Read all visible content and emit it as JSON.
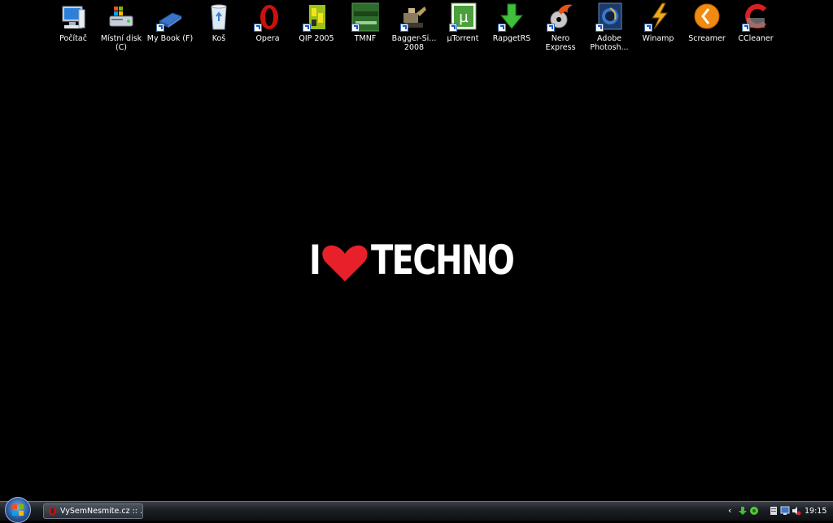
{
  "desktop": {
    "icons": [
      {
        "label": "Počítač",
        "icon": "computer-icon"
      },
      {
        "label": "Místní disk\n(C)",
        "icon": "local-disk-icon"
      },
      {
        "label": "My Book (F)",
        "icon": "external-drive-icon"
      },
      {
        "label": "Koš",
        "icon": "recycle-bin-icon"
      },
      {
        "label": "Opera",
        "icon": "opera-icon"
      },
      {
        "label": "QIP 2005",
        "icon": "qip-icon"
      },
      {
        "label": "TMNF",
        "icon": "tmnf-icon"
      },
      {
        "label": "Bagger-Si...\n2008",
        "icon": "bagger-simulator-icon"
      },
      {
        "label": "µTorrent",
        "icon": "utorrent-icon"
      },
      {
        "label": "RapgetRS",
        "icon": "rapget-icon"
      },
      {
        "label": "Nero Express",
        "icon": "nero-icon"
      },
      {
        "label": "Adobe\nPhotosh...",
        "icon": "photoshop-icon"
      },
      {
        "label": "Winamp",
        "icon": "winamp-icon"
      },
      {
        "label": "Screamer",
        "icon": "screamer-icon"
      },
      {
        "label": "CCleaner",
        "icon": "ccleaner-icon"
      }
    ],
    "wallpaper": {
      "part1": "I",
      "part2": "TECHNO",
      "heart_color": "#e8202a"
    }
  },
  "taskbar": {
    "start_icon": "windows-start-orb",
    "task_button": {
      "label": "VySemNesmite.cz :: ...",
      "icon": "opera-icon"
    },
    "tray": {
      "chevron": "‹",
      "icons": [
        "download-arrow-icon",
        "network-activity-icon",
        "windows-update-icon",
        "display-icon",
        "volume-muted-icon"
      ],
      "clock": "19:15"
    }
  },
  "colors": {
    "taskbar": "#1b1f24",
    "background": "#000000",
    "accent_heart": "#e8202a"
  }
}
